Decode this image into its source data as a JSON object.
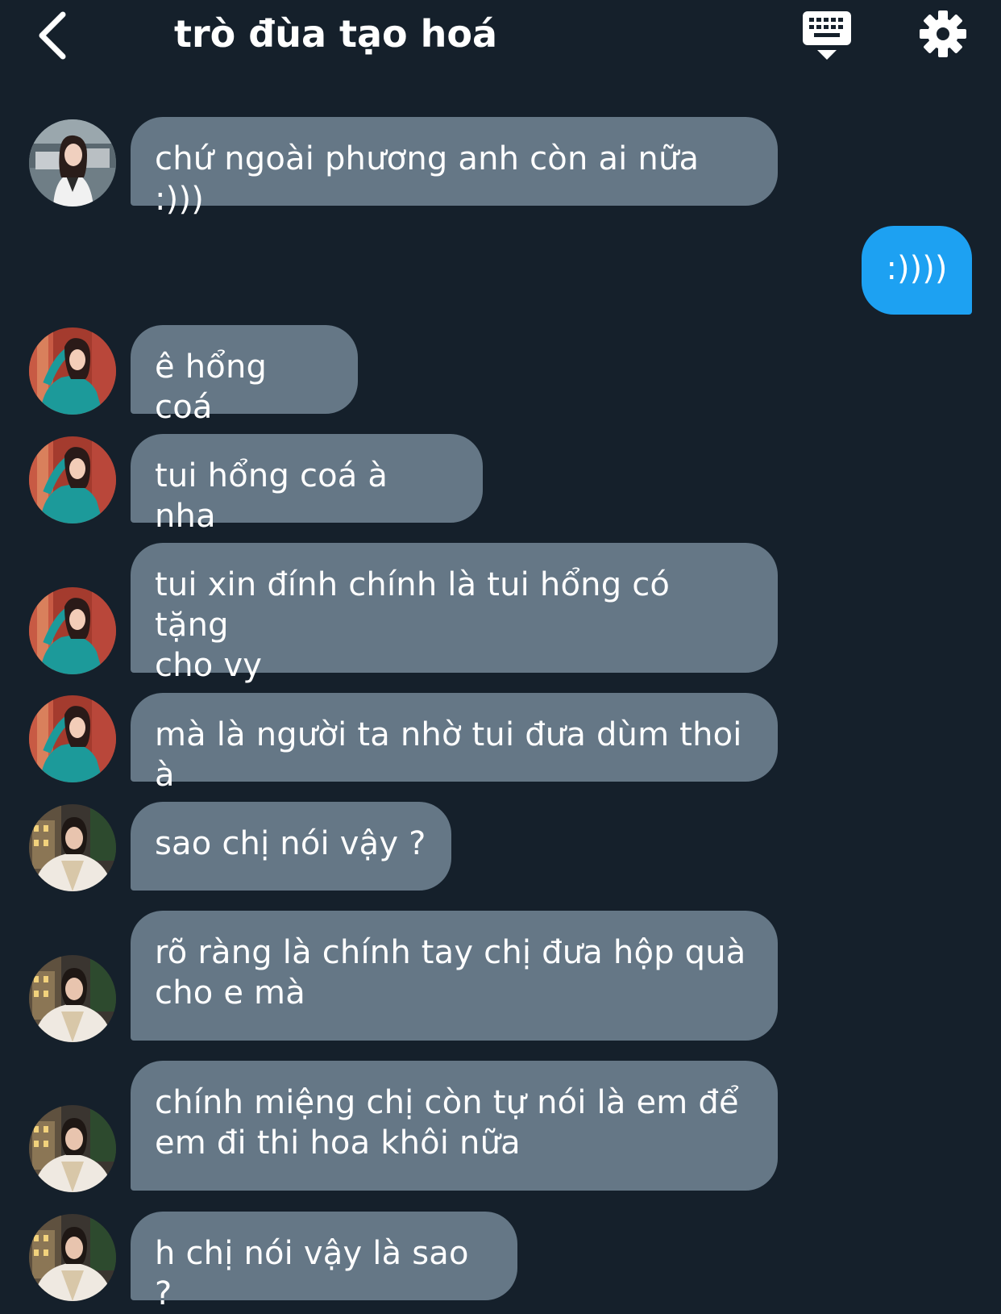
{
  "header": {
    "title": "trò đùa tạo hoá"
  },
  "colors": {
    "background": "#15202b",
    "bubble_in": "#657786",
    "bubble_out": "#1da1f2",
    "text": "#ffffff"
  },
  "icons": {
    "back": "chevron-left-icon",
    "keyboard": "keyboard-icon",
    "settings": "gear-icon"
  },
  "messages": [
    {
      "direction": "in",
      "avatar": "avatar-white-vest",
      "text": "chứ ngoài phương anh còn ai nữa :)))"
    },
    {
      "direction": "out",
      "text": ":))))"
    },
    {
      "direction": "in",
      "avatar": "avatar-teal-dress",
      "text": "ê hổng coá"
    },
    {
      "direction": "in",
      "avatar": "avatar-teal-dress",
      "text": "tui hổng coá à nha"
    },
    {
      "direction": "in",
      "avatar": "avatar-teal-dress",
      "text": "tui xin đính chính là tui hổng có tặng\ncho vy"
    },
    {
      "direction": "in",
      "avatar": "avatar-teal-dress",
      "text": "mà là người ta nhờ tui đưa dùm thoi à"
    },
    {
      "direction": "in",
      "avatar": "avatar-fur-coat",
      "text": "sao chị nói vậy ?"
    },
    {
      "direction": "in",
      "avatar": "avatar-fur-coat",
      "text": "rõ ràng là chính tay chị đưa hộp quà\ncho e mà"
    },
    {
      "direction": "in",
      "avatar": "avatar-fur-coat",
      "text": "chính miệng chị còn tự nói là em để\nem đi thi hoa khôi nữa"
    },
    {
      "direction": "in",
      "avatar": "avatar-fur-coat",
      "text": "h chị nói vậy là sao ?"
    }
  ]
}
